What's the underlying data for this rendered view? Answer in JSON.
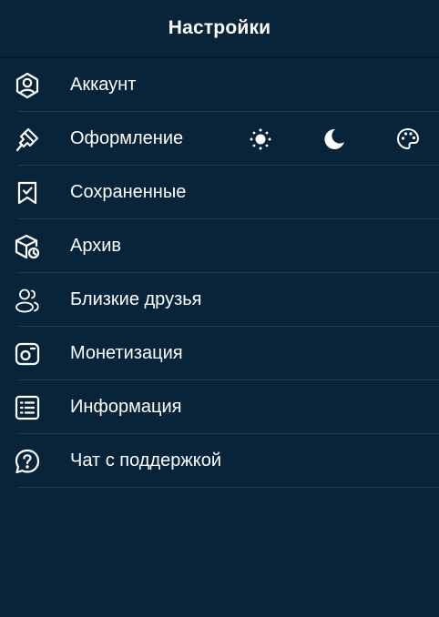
{
  "header": {
    "title": "Настройки"
  },
  "menu": {
    "items": [
      {
        "id": "account",
        "label": "Аккаунт",
        "icon": "account-icon"
      },
      {
        "id": "appearance",
        "label": "Оформление",
        "icon": "paintbrush-icon"
      },
      {
        "id": "saved",
        "label": "Сохраненные",
        "icon": "bookmark-check-icon"
      },
      {
        "id": "archive",
        "label": "Архив",
        "icon": "archive-box-icon"
      },
      {
        "id": "close-friends",
        "label": "Близкие друзья",
        "icon": "friends-icon"
      },
      {
        "id": "monetization",
        "label": "Монетизация",
        "icon": "monetization-icon"
      },
      {
        "id": "info",
        "label": "Информация",
        "icon": "list-icon"
      },
      {
        "id": "support",
        "label": "Чат с поддержкой",
        "icon": "help-chat-icon"
      }
    ]
  },
  "appearance_options": [
    {
      "id": "light",
      "icon": "sun-icon"
    },
    {
      "id": "dark",
      "icon": "moon-icon"
    },
    {
      "id": "custom",
      "icon": "palette-icon"
    }
  ],
  "colors": {
    "background": "#08243a",
    "text": "#ffffff",
    "divider": "#1c3a50"
  }
}
